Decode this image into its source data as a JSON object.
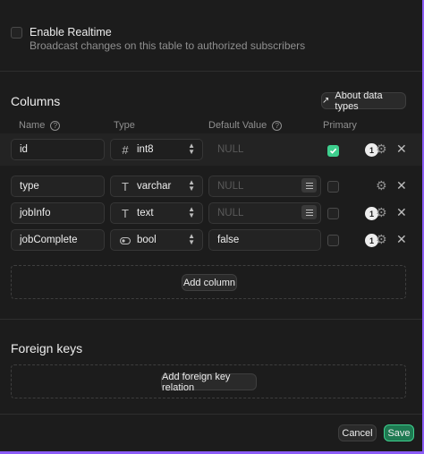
{
  "realtime": {
    "title": "Enable Realtime",
    "description": "Broadcast changes on this table to authorized subscribers",
    "checked": false
  },
  "columns_section": {
    "title": "Columns",
    "about_button": "About data types",
    "headers": {
      "name": "Name",
      "type": "Type",
      "default_value": "Default Value",
      "primary": "Primary"
    },
    "help_glyph": "?",
    "rows": [
      {
        "name": "id",
        "type_icon": "#",
        "type": "int8",
        "default": "NULL",
        "default_is_placeholder": true,
        "primary": true,
        "badge": "1"
      },
      {
        "name": "type",
        "type_icon": "T",
        "type": "varchar",
        "default": "NULL",
        "default_is_placeholder": true,
        "primary": false,
        "badge": ""
      },
      {
        "name": "jobInfo",
        "type_icon": "T",
        "type": "text",
        "default": "NULL",
        "default_is_placeholder": true,
        "primary": false,
        "badge": "1"
      },
      {
        "name": "jobComplete",
        "type_icon": "toggle-icon",
        "type": "bool",
        "default": "false",
        "default_is_placeholder": false,
        "primary": false,
        "badge": "1"
      }
    ],
    "add_column_label": "Add column"
  },
  "foreign_keys": {
    "title": "Foreign keys",
    "add_label": "Add foreign key relation"
  },
  "footer": {
    "cancel_label": "Cancel",
    "save_label": "Save"
  },
  "colors": {
    "accent": "#3ecf8e",
    "border_highlight": "#8b5cf6"
  }
}
